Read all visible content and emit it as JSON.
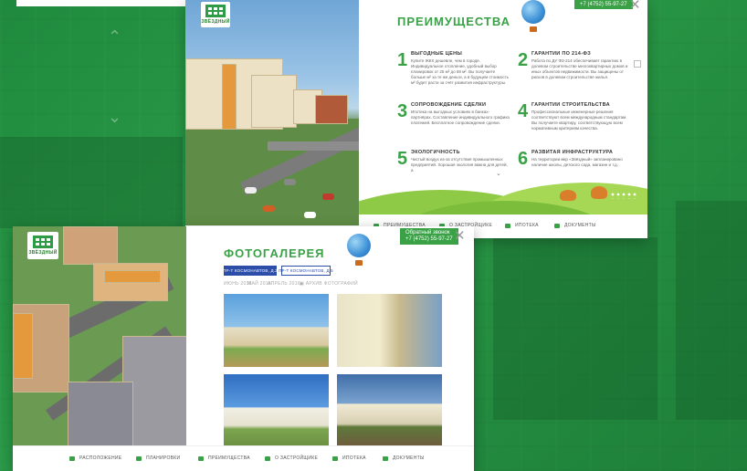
{
  "card1": {
    "logo_text": "ЗВЁЗДНЫЙ",
    "title": "ПРЕИМУЩЕСТВА",
    "phone": "+7 (4752) 55-97-27",
    "close": "✕",
    "advantages": [
      {
        "num": "1",
        "title": "ВЫГОДНЫЕ ЦЕНЫ",
        "text": "Купите ЖКХ дешевле, чем в городе. Индивидуальное отопление, удобный выбор планировок от 25 м² до 69 м². Вы получаете больше м² за те же деньги, а в будущем стоимость м² будет расти за счёт развития инфраструктуры."
      },
      {
        "num": "2",
        "title": "ГАРАНТИИ ПО 214-ФЗ",
        "text": "Работа по ДУ ФЗ-214 обеспечивает гарантию в долевом строительстве многоквартирных домов и иных объектов недвижимости. Вы защищены от рисков в долевом строительстве жилья."
      },
      {
        "num": "3",
        "title": "СОПРОВОЖДЕНИЕ СДЕЛКИ",
        "text": "Ипотека на выгодных условиях в банках-партнёрах. Составление индивидуального графика платежей. Бесплатное сопровождение сделки."
      },
      {
        "num": "4",
        "title": "ГАРАНТИИ СТРОИТЕЛЬСТВА",
        "text": "Профессиональные инженерные решения соответствуют всем международным стандартам. Вы получаете квартиру, соответствующую всем нормативным критериям качества."
      },
      {
        "num": "5",
        "title": "ЭКОЛОГИЧНОСТЬ",
        "text": "Чистый воздух из-за отсутствия промышленных предприятий. Хорошая экология важна для детей, а"
      },
      {
        "num": "6",
        "title": "РАЗВИТАЯ ИНФРАСТРУКТУРА",
        "text": "На территории мкр «Звёздный» запланировано наличие школы, детского сада, магазин и т.д."
      }
    ],
    "nav": [
      "ПРЕИМУЩЕСТВА",
      "О ЗАСТРОЙЩИКЕ",
      "ИПОТЕКА",
      "ДОКУМЕНТЫ"
    ]
  },
  "card2": {
    "logo_text": "ЗВЁЗДНЫЙ",
    "title": "ФОТОГАЛЕРЕЯ",
    "phone_label": "Обратный звонок",
    "phone": "+7 (4752) 55-97-27",
    "close": "✕",
    "addresses": [
      "ПР-Т КОСМОНАВТОВ, Д.3",
      "ПР-Т КОСМОНАВТОВ, Д.5"
    ],
    "dates": [
      "ИЮНЬ 2016",
      "МАЙ 2016",
      "АПРЕЛЬ 2016"
    ],
    "archive": "АРХИВ ФОТОГРАФИЙ",
    "nav": [
      "РАСПОЛОЖЕНИЕ",
      "ПЛАНИРОВКИ",
      "ПРЕИМУЩЕСТВА",
      "О ЗАСТРОЙЩИКЕ",
      "ИПОТЕКА",
      "ДОКУМЕНТЫ"
    ]
  },
  "colors": {
    "accent": "#3aa147",
    "background": "#2a9a48",
    "address_active": "#2c4da8"
  }
}
